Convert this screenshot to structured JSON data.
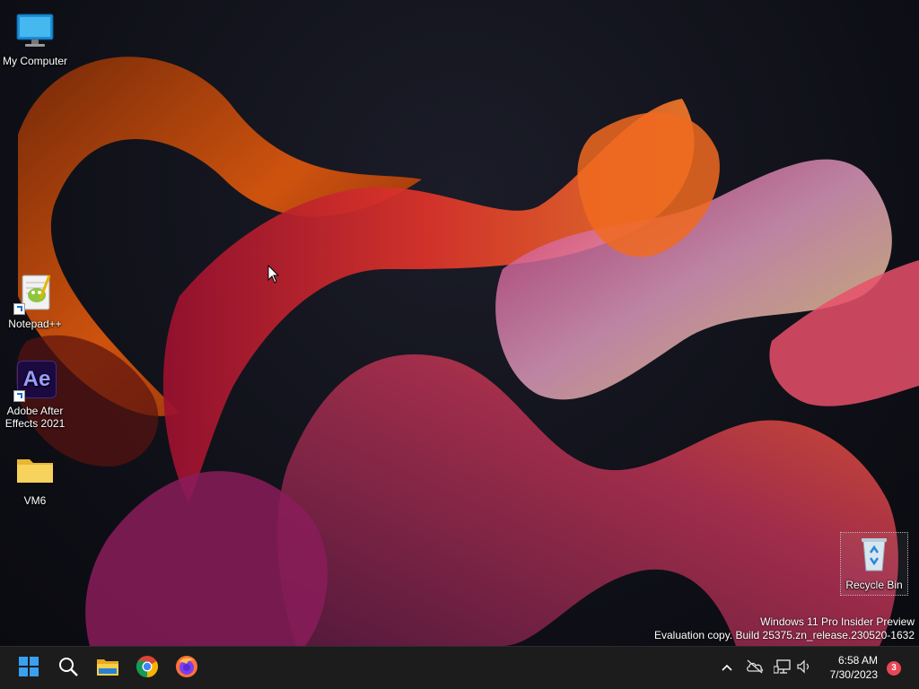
{
  "desktop": {
    "icons": [
      {
        "label": "My Computer"
      },
      {
        "label": "Notepad++"
      },
      {
        "label": "Adobe After Effects 2021",
        "glyph_text": "Ae"
      },
      {
        "label": "VM6"
      },
      {
        "label": "Recycle Bin"
      }
    ],
    "watermark": {
      "line1": "Windows 11 Pro Insider Preview",
      "line2": "Evaluation copy. Build 25375.zn_release.230520-1632"
    }
  },
  "taskbar": {
    "pinned": [
      {
        "icon": "windows-start-icon"
      },
      {
        "icon": "search-icon"
      },
      {
        "icon": "file-explorer-icon"
      },
      {
        "icon": "chrome-icon"
      },
      {
        "icon": "firefox-icon"
      }
    ],
    "tray": {
      "icons": [
        "show-hidden-icons-chevron",
        "onedrive-offline-icon",
        "network-icon",
        "volume-icon"
      ],
      "time": "6:58 AM",
      "date": "7/30/2023",
      "notification_count": "3"
    }
  },
  "colors": {
    "taskbar_bg": "#1c1c1c",
    "start_blue": "#3aa0f0",
    "badge_red": "#e74856"
  }
}
